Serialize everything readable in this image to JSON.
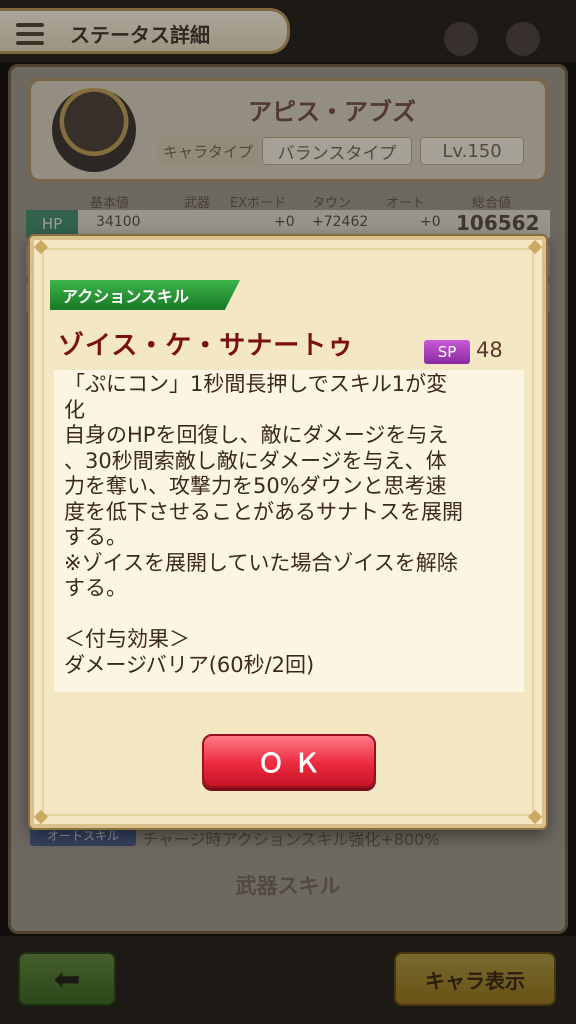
{
  "header": {
    "title": "ステータス詳細"
  },
  "character": {
    "name": "アピス・アブズ",
    "type_label": "キャラタイプ",
    "type_value": "バランスタイプ",
    "level": "Lv.150"
  },
  "stats": {
    "headers": [
      "基本値",
      "武器",
      "EXボード",
      "タウン",
      "オート",
      "総合値"
    ],
    "hp": {
      "label": "HP",
      "base": "34100",
      "ex": "+0",
      "town": "+72462",
      "auto": "+0",
      "total": "106562"
    }
  },
  "auto_skill": {
    "label": "オートスキル",
    "text": "チャージ時アクションスキル強化+800%"
  },
  "weapon_skill": {
    "label": "武器スキル"
  },
  "footer": {
    "chara_button": "キャラ表示"
  },
  "dialog": {
    "tag": "アクションスキル",
    "skill_name": "ゾイス・ケ・サナートゥ",
    "sp_label": "SP",
    "sp_value": "48",
    "description_lines": [
      "「ぷにコン」1秒間長押しでスキル1が変",
      "化",
      "自身のHPを回復し、敵にダメージを与え",
      "、30秒間索敵し敵にダメージを与え、体",
      "力を奪い、攻撃力を50%ダウンと思考速",
      "度を低下させることがあるサナトスを展開",
      "する。",
      "※ゾイスを展開していた場合ゾイスを解除",
      "する。",
      "",
      "＜付与効果＞",
      "ダメージバリア(60秒/2回)"
    ],
    "ok_label": "ＯＫ"
  },
  "colors": {
    "skill_name": "#7a1010",
    "tag_green": "#177a25",
    "sp_purple": "#8a2aa0",
    "ok_red": "#ec2a3e"
  }
}
